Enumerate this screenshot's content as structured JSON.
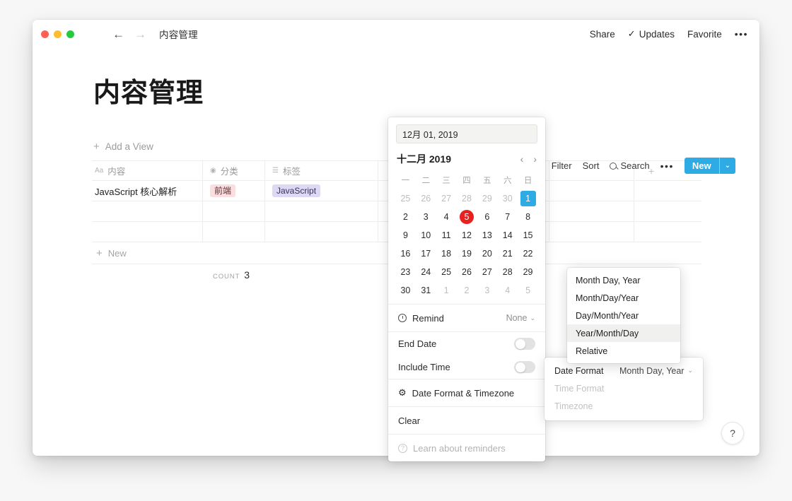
{
  "titlebar": {
    "breadcrumb": "内容管理",
    "back_icon": "arrow-left-icon",
    "forward_icon": "arrow-right-icon",
    "menu_icon": "hamburger-icon",
    "share": "Share",
    "updates": "Updates",
    "favorite": "Favorite",
    "more": "•••"
  },
  "page": {
    "title": "内容管理",
    "add_view": "Add a View",
    "new_row": "New",
    "count_label": "COUNT",
    "count_value": "3",
    "help": "?"
  },
  "view_toolbar": {
    "filter": "Filter",
    "sort": "Sort",
    "search": "Search",
    "more": "•••",
    "new_label": "New",
    "new_caret": "⌄",
    "accent": "#2eabe4"
  },
  "table": {
    "columns": [
      {
        "label": "内容",
        "icon": "text-icon",
        "icon_glyph": "Aa"
      },
      {
        "label": "分类",
        "icon": "select-icon",
        "icon_glyph": "◉"
      },
      {
        "label": "标签",
        "icon": "multiselect-icon",
        "icon_glyph": "☰"
      },
      {
        "label": "",
        "icon": "",
        "icon_glyph": ""
      },
      {
        "label": "",
        "icon": "",
        "icon_glyph": ""
      },
      {
        "label": "",
        "icon": "add-column-icon",
        "icon_glyph": "+"
      }
    ],
    "rows": [
      {
        "title": "JavaScript 核心解析",
        "category": "前端",
        "category_color": "#fbdfe0",
        "tag": "JavaScript",
        "tag_color": "#ddd9f4"
      },
      {
        "title": "",
        "category": "",
        "tag": ""
      },
      {
        "title": "",
        "category": "",
        "tag": ""
      }
    ]
  },
  "datepicker": {
    "input_value": "12月 01, 2019",
    "month_label": "十二月 2019",
    "prev_icon": "chevron-left-icon",
    "next_icon": "chevron-right-icon",
    "weekdays": [
      "一",
      "二",
      "三",
      "四",
      "五",
      "六",
      "日"
    ],
    "days": [
      {
        "d": "25",
        "state": "out"
      },
      {
        "d": "26",
        "state": "out"
      },
      {
        "d": "27",
        "state": "out"
      },
      {
        "d": "28",
        "state": "out"
      },
      {
        "d": "29",
        "state": "out"
      },
      {
        "d": "30",
        "state": "out"
      },
      {
        "d": "1",
        "state": "sel"
      },
      {
        "d": "2",
        "state": ""
      },
      {
        "d": "3",
        "state": ""
      },
      {
        "d": "4",
        "state": ""
      },
      {
        "d": "5",
        "state": "today"
      },
      {
        "d": "6",
        "state": ""
      },
      {
        "d": "7",
        "state": ""
      },
      {
        "d": "8",
        "state": ""
      },
      {
        "d": "9",
        "state": ""
      },
      {
        "d": "10",
        "state": ""
      },
      {
        "d": "11",
        "state": ""
      },
      {
        "d": "12",
        "state": ""
      },
      {
        "d": "13",
        "state": ""
      },
      {
        "d": "14",
        "state": ""
      },
      {
        "d": "15",
        "state": ""
      },
      {
        "d": "16",
        "state": ""
      },
      {
        "d": "17",
        "state": ""
      },
      {
        "d": "18",
        "state": ""
      },
      {
        "d": "19",
        "state": ""
      },
      {
        "d": "20",
        "state": ""
      },
      {
        "d": "21",
        "state": ""
      },
      {
        "d": "22",
        "state": ""
      },
      {
        "d": "23",
        "state": ""
      },
      {
        "d": "24",
        "state": ""
      },
      {
        "d": "25",
        "state": ""
      },
      {
        "d": "26",
        "state": ""
      },
      {
        "d": "27",
        "state": ""
      },
      {
        "d": "28",
        "state": ""
      },
      {
        "d": "29",
        "state": ""
      },
      {
        "d": "30",
        "state": ""
      },
      {
        "d": "31",
        "state": ""
      },
      {
        "d": "1",
        "state": "out"
      },
      {
        "d": "2",
        "state": "out"
      },
      {
        "d": "3",
        "state": "out"
      },
      {
        "d": "4",
        "state": "out"
      },
      {
        "d": "5",
        "state": "out"
      }
    ],
    "remind_label": "Remind",
    "remind_value": "None",
    "remind_caret": "⌄",
    "end_date_label": "End Date",
    "end_date_on": false,
    "include_time_label": "Include Time",
    "include_time_on": false,
    "format_timezone_label": "Date Format & Timezone",
    "clear_label": "Clear",
    "learn_label": "Learn about reminders",
    "selected_day": "1",
    "today_day": "5",
    "selected_color": "#2eabe4",
    "today_color": "#e8201f"
  },
  "format_panel": {
    "date_format_label": "Date Format",
    "date_format_value": "Month Day, Year",
    "date_format_caret": "⌄",
    "time_format_label": "Time Format",
    "timezone_label": "Timezone"
  },
  "format_dropdown": {
    "options": [
      {
        "label": "Month Day, Year",
        "highlighted": false
      },
      {
        "label": "Month/Day/Year",
        "highlighted": false
      },
      {
        "label": "Day/Month/Year",
        "highlighted": false
      },
      {
        "label": "Year/Month/Day",
        "highlighted": true
      },
      {
        "label": "Relative",
        "highlighted": false
      }
    ]
  }
}
